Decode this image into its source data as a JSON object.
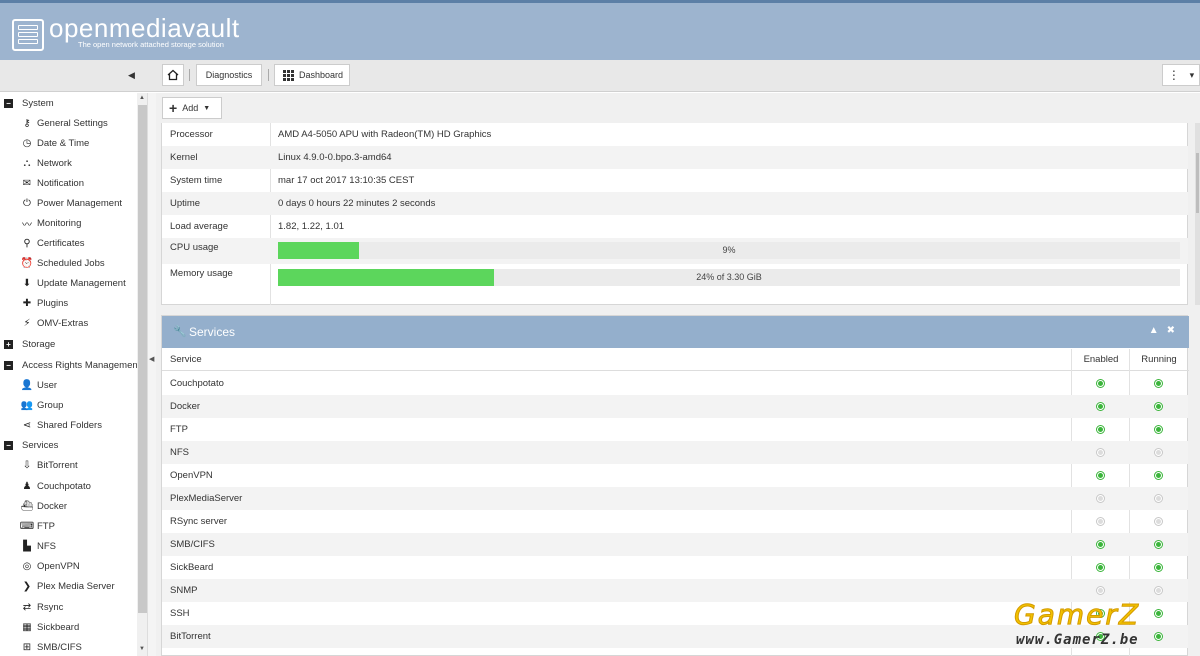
{
  "app": {
    "name": "openmediavault",
    "tagline": "The open network attached storage solution"
  },
  "toolbar": {
    "home_icon": "home-icon",
    "breadcrumbs": [
      "Diagnostics",
      "Dashboard"
    ],
    "more_icon": "⋮",
    "caret_icon": "▾"
  },
  "sidebar": {
    "groups": [
      {
        "label": "System",
        "state": "expanded",
        "children": [
          {
            "label": "General Settings",
            "icon": "key-icon"
          },
          {
            "label": "Date & Time",
            "icon": "clock-icon"
          },
          {
            "label": "Network",
            "icon": "network-icon"
          },
          {
            "label": "Notification",
            "icon": "envelope-icon"
          },
          {
            "label": "Power Management",
            "icon": "power-icon"
          },
          {
            "label": "Monitoring",
            "icon": "chart-icon"
          },
          {
            "label": "Certificates",
            "icon": "certificate-icon"
          },
          {
            "label": "Scheduled Jobs",
            "icon": "alarm-icon"
          },
          {
            "label": "Update Management",
            "icon": "download-icon"
          },
          {
            "label": "Plugins",
            "icon": "puzzle-icon"
          },
          {
            "label": "OMV-Extras",
            "icon": "plug-icon"
          }
        ]
      },
      {
        "label": "Storage",
        "state": "collapsed",
        "children": []
      },
      {
        "label": "Access Rights Managemen",
        "state": "expanded",
        "children": [
          {
            "label": "User",
            "icon": "user-icon"
          },
          {
            "label": "Group",
            "icon": "group-icon"
          },
          {
            "label": "Shared Folders",
            "icon": "share-icon"
          }
        ]
      },
      {
        "label": "Services",
        "state": "expanded",
        "children": [
          {
            "label": "BitTorrent",
            "icon": "bittorrent-icon"
          },
          {
            "label": "Couchpotato",
            "icon": "couchpotato-icon"
          },
          {
            "label": "Docker",
            "icon": "docker-icon"
          },
          {
            "label": "FTP",
            "icon": "ftp-icon"
          },
          {
            "label": "NFS",
            "icon": "nfs-icon"
          },
          {
            "label": "OpenVPN",
            "icon": "openvpn-icon"
          },
          {
            "label": "Plex Media Server",
            "icon": "plex-icon"
          },
          {
            "label": "Rsync",
            "icon": "rsync-icon"
          },
          {
            "label": "Sickbeard",
            "icon": "sickbeard-icon"
          },
          {
            "label": "SMB/CIFS",
            "icon": "windows-icon"
          }
        ]
      }
    ]
  },
  "main": {
    "add_button": "Add",
    "system_info": [
      {
        "label": "Processor",
        "value": "AMD A4-5050 APU with Radeon(TM) HD Graphics"
      },
      {
        "label": "Kernel",
        "value": "Linux 4.9.0-0.bpo.3-amd64"
      },
      {
        "label": "System time",
        "value": "mar 17 oct 2017 13:10:35 CEST"
      },
      {
        "label": "Uptime",
        "value": "0 days 0 hours 22 minutes 2 seconds"
      },
      {
        "label": "Load average",
        "value": "1.82, 1.22, 1.01"
      }
    ],
    "cpu": {
      "label": "CPU usage",
      "text": "9%",
      "percent": 9
    },
    "memory": {
      "label": "Memory usage",
      "text": "24% of 3.30 GiB",
      "percent": 24
    },
    "services_panel": {
      "title": "Services",
      "columns": [
        "Service",
        "Enabled",
        "Running"
      ],
      "rows": [
        {
          "name": "Couchpotato",
          "enabled": true,
          "running": true
        },
        {
          "name": "Docker",
          "enabled": true,
          "running": true
        },
        {
          "name": "FTP",
          "enabled": true,
          "running": true
        },
        {
          "name": "NFS",
          "enabled": false,
          "running": false
        },
        {
          "name": "OpenVPN",
          "enabled": true,
          "running": true
        },
        {
          "name": "PlexMediaServer",
          "enabled": false,
          "running": false
        },
        {
          "name": "RSync server",
          "enabled": false,
          "running": false
        },
        {
          "name": "SMB/CIFS",
          "enabled": true,
          "running": true
        },
        {
          "name": "SickBeard",
          "enabled": true,
          "running": true
        },
        {
          "name": "SNMP",
          "enabled": false,
          "running": false
        },
        {
          "name": "SSH",
          "enabled": true,
          "running": true
        },
        {
          "name": "BitTorrent",
          "enabled": true,
          "running": true
        }
      ]
    }
  },
  "watermark": {
    "line1": "GamerZ",
    "line2": "www.GamerZ.be"
  },
  "colors": {
    "header": "#9db4cf",
    "panel_header": "#94afcc",
    "progress": "#5cd65c",
    "status_on": "#3bb53b"
  }
}
